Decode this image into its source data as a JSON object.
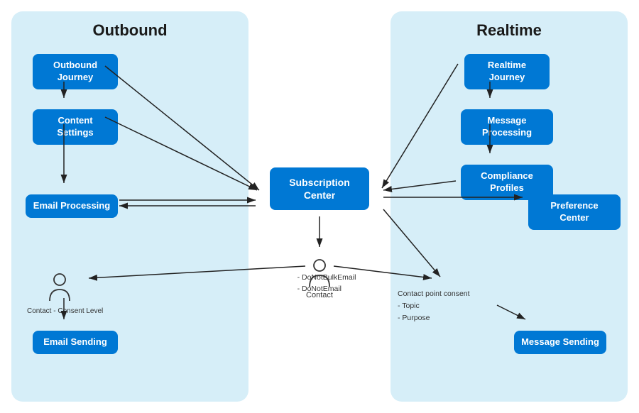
{
  "panels": {
    "outbound": {
      "title": "Outbound",
      "boxes": {
        "outbound_journey": "Outbound\nJourney",
        "content_settings": "Content\nSettings",
        "email_processing": "Email\nProcessing",
        "email_sending": "Email\nSending"
      },
      "contact_label": "Contact -  Consent Level"
    },
    "realtime": {
      "title": "Realtime",
      "boxes": {
        "realtime_journey": "Realtime\nJourney",
        "message_processing": "Message\nProcessing",
        "compliance_profiles": "Compliance\nProfiles",
        "preference_center": "Preference\nCenter",
        "message_sending": "Message\nSending"
      },
      "contact_point_text": "Contact point consent\n- Topic\n- Purpose"
    }
  },
  "center": {
    "subscription_center": "Subscription\nCenter",
    "contact_label": "Contact",
    "contact_fields": "- DoNotBulkEmail\n- DoNotEmail"
  }
}
